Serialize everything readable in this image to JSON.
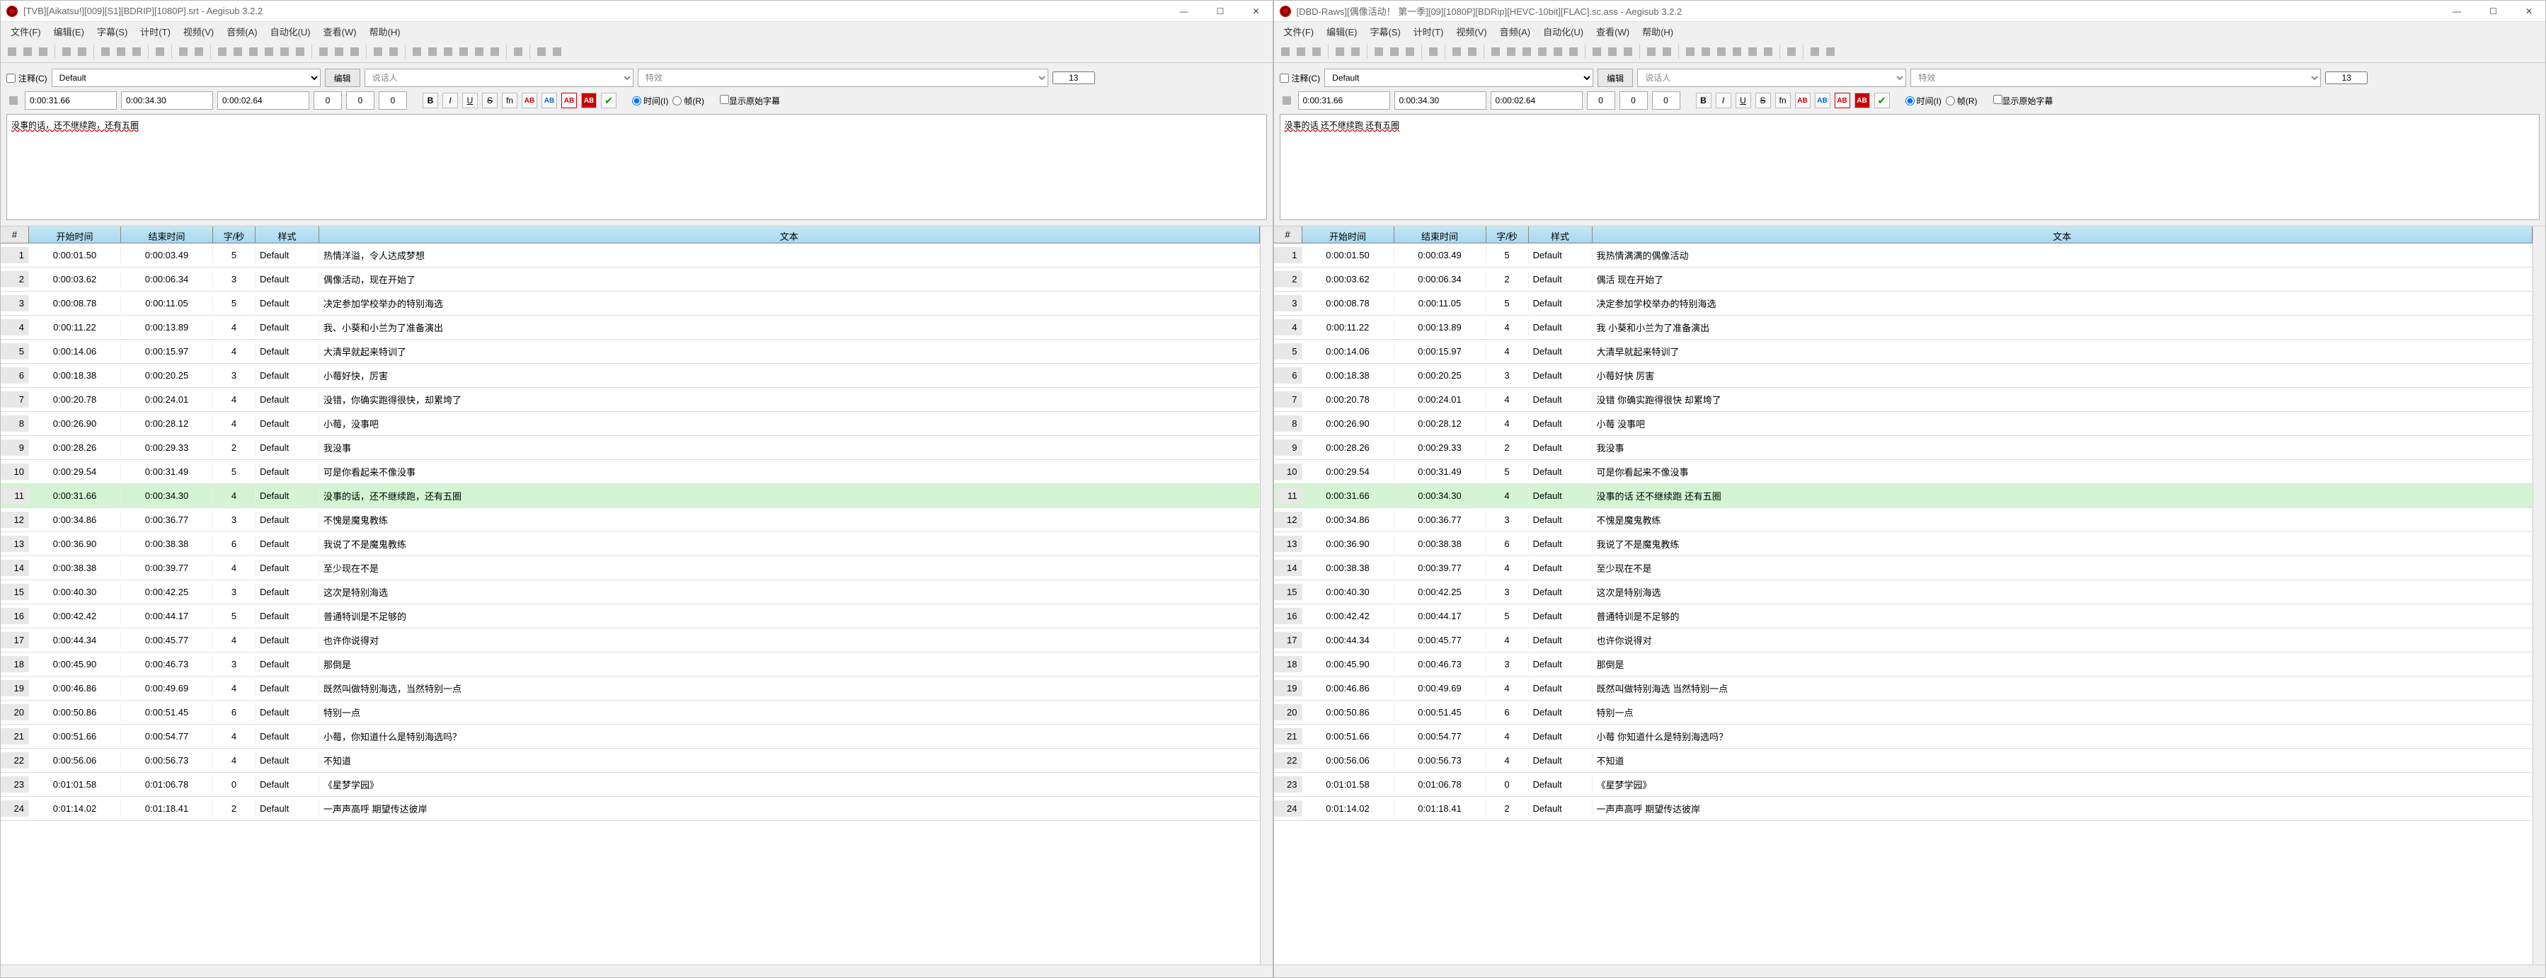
{
  "windows": [
    {
      "id": "left",
      "title": "[TVB][Aikatsu!][009][S1][BDRIP][1080P].srt - Aegisub 3.2.2",
      "edit_text": "没事的话，还不继续跑，还有五圈",
      "selected_row": 11
    },
    {
      "id": "right",
      "title": "[DBD-Raws][偶像活动！ 第一季][09][1080P][BDRip][HEVC-10bit][FLAC].sc.ass - Aegisub 3.2.2",
      "edit_text": "没事的话 还不继续跑 还有五圈",
      "selected_row": 11
    }
  ],
  "menu": [
    "文件(F)",
    "编辑(E)",
    "字幕(S)",
    "计时(T)",
    "视频(V)",
    "音频(A)",
    "自动化(U)",
    "查看(W)",
    "帮助(H)"
  ],
  "winbtns": {
    "min": "—",
    "max": "☐",
    "close": "✕"
  },
  "edit": {
    "comment_label": "注释(C)",
    "style_value": "Default",
    "edit_btn": "编辑",
    "actor_placeholder": "说话人",
    "effect_placeholder": "特效",
    "layer_value": "13",
    "start_time": "0:00:31.66",
    "end_time": "0:00:34.30",
    "duration": "0:00:02.64",
    "margin_l": "0",
    "margin_r": "0",
    "margin_v": "0",
    "fn_btn": "fn",
    "ab_btn": "AB",
    "time_label": "时间(I)",
    "frame_label": "帧(R)",
    "show_orig_label": "显示原始字幕"
  },
  "grid_headers": {
    "num": "#",
    "start": "开始时间",
    "end": "结束时间",
    "cps": "字/秒",
    "style": "样式",
    "text": "文本"
  },
  "rows_left": [
    {
      "n": 1,
      "s": "0:00:01.50",
      "e": "0:00:03.49",
      "c": "5",
      "st": "Default",
      "t": "热情洋溢，令人达成梦想"
    },
    {
      "n": 2,
      "s": "0:00:03.62",
      "e": "0:00:06.34",
      "c": "3",
      "st": "Default",
      "t": "偶像活动，现在开始了"
    },
    {
      "n": 3,
      "s": "0:00:08.78",
      "e": "0:00:11.05",
      "c": "5",
      "st": "Default",
      "t": "决定参加学校举办的特别海选"
    },
    {
      "n": 4,
      "s": "0:00:11.22",
      "e": "0:00:13.89",
      "c": "4",
      "st": "Default",
      "t": "我、小葵和小兰为了准备演出"
    },
    {
      "n": 5,
      "s": "0:00:14.06",
      "e": "0:00:15.97",
      "c": "4",
      "st": "Default",
      "t": "大清早就起来特训了"
    },
    {
      "n": 6,
      "s": "0:00:18.38",
      "e": "0:00:20.25",
      "c": "3",
      "st": "Default",
      "t": "小莓好快，厉害"
    },
    {
      "n": 7,
      "s": "0:00:20.78",
      "e": "0:00:24.01",
      "c": "4",
      "st": "Default",
      "t": "没错，你确实跑得很快，却累垮了"
    },
    {
      "n": 8,
      "s": "0:00:26.90",
      "e": "0:00:28.12",
      "c": "4",
      "st": "Default",
      "t": "小莓，没事吧"
    },
    {
      "n": 9,
      "s": "0:00:28.26",
      "e": "0:00:29.33",
      "c": "2",
      "st": "Default",
      "t": "我没事"
    },
    {
      "n": 10,
      "s": "0:00:29.54",
      "e": "0:00:31.49",
      "c": "5",
      "st": "Default",
      "t": "可是你看起来不像没事"
    },
    {
      "n": 11,
      "s": "0:00:31.66",
      "e": "0:00:34.30",
      "c": "4",
      "st": "Default",
      "t": "没事的话，还不继续跑，还有五圈"
    },
    {
      "n": 12,
      "s": "0:00:34.86",
      "e": "0:00:36.77",
      "c": "3",
      "st": "Default",
      "t": "不愧是魔鬼教练"
    },
    {
      "n": 13,
      "s": "0:00:36.90",
      "e": "0:00:38.38",
      "c": "6",
      "st": "Default",
      "t": "我说了不是魔鬼教练"
    },
    {
      "n": 14,
      "s": "0:00:38.38",
      "e": "0:00:39.77",
      "c": "4",
      "st": "Default",
      "t": "至少现在不是"
    },
    {
      "n": 15,
      "s": "0:00:40.30",
      "e": "0:00:42.25",
      "c": "3",
      "st": "Default",
      "t": "这次是特别海选"
    },
    {
      "n": 16,
      "s": "0:00:42.42",
      "e": "0:00:44.17",
      "c": "5",
      "st": "Default",
      "t": "普通特训是不足够的"
    },
    {
      "n": 17,
      "s": "0:00:44.34",
      "e": "0:00:45.77",
      "c": "4",
      "st": "Default",
      "t": "也许你说得对"
    },
    {
      "n": 18,
      "s": "0:00:45.90",
      "e": "0:00:46.73",
      "c": "3",
      "st": "Default",
      "t": "那倒是"
    },
    {
      "n": 19,
      "s": "0:00:46.86",
      "e": "0:00:49.69",
      "c": "4",
      "st": "Default",
      "t": "既然叫做特别海选，当然特别一点"
    },
    {
      "n": 20,
      "s": "0:00:50.86",
      "e": "0:00:51.45",
      "c": "6",
      "st": "Default",
      "t": "特别一点"
    },
    {
      "n": 21,
      "s": "0:00:51.66",
      "e": "0:00:54.77",
      "c": "4",
      "st": "Default",
      "t": "小莓，你知道什么是特别海选吗？"
    },
    {
      "n": 22,
      "s": "0:00:56.06",
      "e": "0:00:56.73",
      "c": "4",
      "st": "Default",
      "t": "不知道"
    },
    {
      "n": 23,
      "s": "0:01:01.58",
      "e": "0:01:06.78",
      "c": "0",
      "st": "Default",
      "t": "《星梦学园》"
    },
    {
      "n": 24,
      "s": "0:01:14.02",
      "e": "0:01:18.41",
      "c": "2",
      "st": "Default",
      "t": "一声声高呼 期望传达彼岸"
    }
  ],
  "rows_right": [
    {
      "n": 1,
      "s": "0:00:01.50",
      "e": "0:00:03.49",
      "c": "5",
      "st": "Default",
      "t": "我热情满满的偶像活动"
    },
    {
      "n": 2,
      "s": "0:00:03.62",
      "e": "0:00:06.34",
      "c": "2",
      "st": "Default",
      "t": "偶活 现在开始了"
    },
    {
      "n": 3,
      "s": "0:00:08.78",
      "e": "0:00:11.05",
      "c": "5",
      "st": "Default",
      "t": "决定参加学校举办的特别海选"
    },
    {
      "n": 4,
      "s": "0:00:11.22",
      "e": "0:00:13.89",
      "c": "4",
      "st": "Default",
      "t": "我 小葵和小兰为了准备演出"
    },
    {
      "n": 5,
      "s": "0:00:14.06",
      "e": "0:00:15.97",
      "c": "4",
      "st": "Default",
      "t": "大清早就起来特训了"
    },
    {
      "n": 6,
      "s": "0:00:18.38",
      "e": "0:00:20.25",
      "c": "3",
      "st": "Default",
      "t": "小莓好快 厉害"
    },
    {
      "n": 7,
      "s": "0:00:20.78",
      "e": "0:00:24.01",
      "c": "4",
      "st": "Default",
      "t": "没错 你确实跑得很快 却累垮了"
    },
    {
      "n": 8,
      "s": "0:00:26.90",
      "e": "0:00:28.12",
      "c": "4",
      "st": "Default",
      "t": "小莓 没事吧"
    },
    {
      "n": 9,
      "s": "0:00:28.26",
      "e": "0:00:29.33",
      "c": "2",
      "st": "Default",
      "t": "我没事"
    },
    {
      "n": 10,
      "s": "0:00:29.54",
      "e": "0:00:31.49",
      "c": "5",
      "st": "Default",
      "t": "可是你看起来不像没事"
    },
    {
      "n": 11,
      "s": "0:00:31.66",
      "e": "0:00:34.30",
      "c": "4",
      "st": "Default",
      "t": "没事的话 还不继续跑 还有五圈"
    },
    {
      "n": 12,
      "s": "0:00:34.86",
      "e": "0:00:36.77",
      "c": "3",
      "st": "Default",
      "t": "不愧是魔鬼教练"
    },
    {
      "n": 13,
      "s": "0:00:36.90",
      "e": "0:00:38.38",
      "c": "6",
      "st": "Default",
      "t": "我说了不是魔鬼教练"
    },
    {
      "n": 14,
      "s": "0:00:38.38",
      "e": "0:00:39.77",
      "c": "4",
      "st": "Default",
      "t": "至少现在不是"
    },
    {
      "n": 15,
      "s": "0:00:40.30",
      "e": "0:00:42.25",
      "c": "3",
      "st": "Default",
      "t": "这次是特别海选"
    },
    {
      "n": 16,
      "s": "0:00:42.42",
      "e": "0:00:44.17",
      "c": "5",
      "st": "Default",
      "t": "普通特训是不足够的"
    },
    {
      "n": 17,
      "s": "0:00:44.34",
      "e": "0:00:45.77",
      "c": "4",
      "st": "Default",
      "t": "也许你说得对"
    },
    {
      "n": 18,
      "s": "0:00:45.90",
      "e": "0:00:46.73",
      "c": "3",
      "st": "Default",
      "t": "那倒是"
    },
    {
      "n": 19,
      "s": "0:00:46.86",
      "e": "0:00:49.69",
      "c": "4",
      "st": "Default",
      "t": "既然叫做特别海选 当然特别一点"
    },
    {
      "n": 20,
      "s": "0:00:50.86",
      "e": "0:00:51.45",
      "c": "6",
      "st": "Default",
      "t": "特别一点"
    },
    {
      "n": 21,
      "s": "0:00:51.66",
      "e": "0:00:54.77",
      "c": "4",
      "st": "Default",
      "t": "小莓 你知道什么是特别海选吗？"
    },
    {
      "n": 22,
      "s": "0:00:56.06",
      "e": "0:00:56.73",
      "c": "4",
      "st": "Default",
      "t": "不知道"
    },
    {
      "n": 23,
      "s": "0:01:01.58",
      "e": "0:01:06.78",
      "c": "0",
      "st": "Default",
      "t": "《星梦学园》"
    },
    {
      "n": 24,
      "s": "0:01:14.02",
      "e": "0:01:18.41",
      "c": "2",
      "st": "Default",
      "t": "一声声高呼 期望传达彼岸"
    }
  ],
  "toolbar_icons": [
    "new",
    "open",
    "save",
    "sep",
    "video-open",
    "video-close",
    "sep",
    "audio-open",
    "audio-wave",
    "audio-close",
    "sep",
    "jump",
    "sep",
    "zoom-in",
    "zoom-out",
    "sep",
    "snap-start",
    "snap-end",
    "select-visible",
    "snap-scene",
    "shift-start",
    "shift-end",
    "sep",
    "styles",
    "attach",
    "fonts",
    "sep",
    "automation",
    "ass-override",
    "sep",
    "shift-times",
    "styling-assistant",
    "translation-assistant",
    "resample",
    "timing-postproc",
    "kanji-timer",
    "sep",
    "spellcheck",
    "sep",
    "settings",
    "cycle-tag"
  ]
}
